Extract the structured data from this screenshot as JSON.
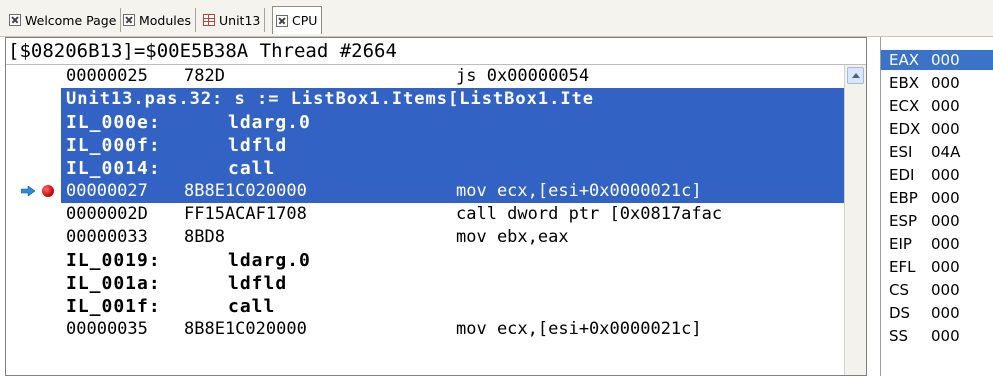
{
  "tabs": [
    {
      "label": "Welcome Page",
      "icon": "close-icon"
    },
    {
      "label": "Modules",
      "icon": "close-icon"
    },
    {
      "label": "Unit13",
      "icon": "grid-icon"
    },
    {
      "label": "CPU",
      "icon": "close-icon"
    }
  ],
  "cpu": {
    "address_line": "[$08206B13]=$00E5B38A Thread #2664",
    "rows": [
      {
        "kind": "asm",
        "addr": "00000025",
        "bytes": "782D",
        "asm": "js 0x00000054"
      },
      {
        "kind": "src",
        "text": "Unit13.pas.32: s := ListBox1.Items[ListBox1.Ite"
      },
      {
        "kind": "il",
        "label": "IL_000e:",
        "op": "ldarg.0"
      },
      {
        "kind": "il",
        "label": "IL_000f:",
        "op": "ldfld"
      },
      {
        "kind": "il",
        "label": "IL_0014:",
        "op": "call"
      },
      {
        "kind": "asm",
        "addr": "00000027",
        "bytes": "8B8E1C020000",
        "asm": "mov ecx,[esi+0x0000021c]",
        "current": true
      },
      {
        "kind": "asm",
        "addr": "0000002D",
        "bytes": "FF15ACAF1708",
        "asm": "call dword ptr [0x0817afac"
      },
      {
        "kind": "asm",
        "addr": "00000033",
        "bytes": "8BD8",
        "asm": "mov ebx,eax"
      },
      {
        "kind": "il",
        "label": "IL_0019:",
        "op": "ldarg.0"
      },
      {
        "kind": "il",
        "label": "IL_001a:",
        "op": "ldfld"
      },
      {
        "kind": "il",
        "label": "IL_001f:",
        "op": "call"
      },
      {
        "kind": "asm",
        "addr": "00000035",
        "bytes": "8B8E1C020000",
        "asm": "mov ecx,[esi+0x0000021c]"
      }
    ]
  },
  "registers": [
    {
      "name": "EAX",
      "value": "000"
    },
    {
      "name": "EBX",
      "value": "000"
    },
    {
      "name": "ECX",
      "value": "000"
    },
    {
      "name": "EDX",
      "value": "000"
    },
    {
      "name": "ESI",
      "value": "04A"
    },
    {
      "name": "EDI",
      "value": "000"
    },
    {
      "name": "EBP",
      "value": "000"
    },
    {
      "name": "ESP",
      "value": "000"
    },
    {
      "name": "EIP",
      "value": "000"
    },
    {
      "name": "EFL",
      "value": "000"
    },
    {
      "name": "CS",
      "value": "000"
    },
    {
      "name": "DS",
      "value": "000"
    },
    {
      "name": "SS",
      "value": "000"
    }
  ],
  "colors": {
    "selection": "#3162c4",
    "register_highlight": "#3a73c8",
    "breakpoint": "#d41010",
    "exec_arrow": "#2a8bd8"
  }
}
